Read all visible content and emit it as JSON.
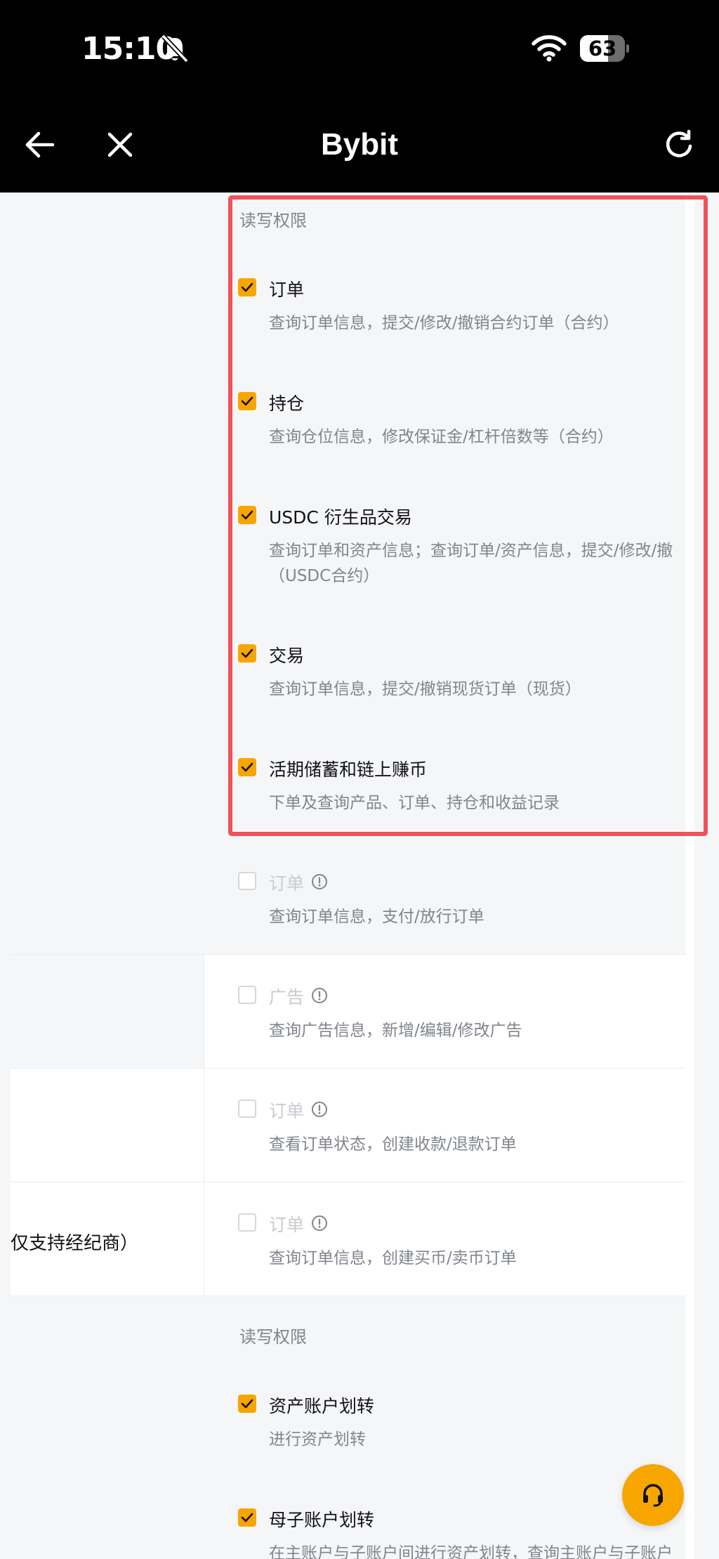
{
  "status_bar": {
    "time": "15:10",
    "battery_level": "63",
    "battery_fraction": 0.63
  },
  "nav": {
    "title": "Bybit",
    "back_icon": "arrow-left-icon",
    "close_icon": "close-icon",
    "refresh_icon": "refresh-icon"
  },
  "permissions": {
    "section1": {
      "header": "读写权限",
      "items": [
        {
          "title": "订单",
          "desc": "查询订单信息，提交/修改/撤销合约订单（合约）",
          "checked": true
        },
        {
          "title": "持仓",
          "desc": "查询仓位信息，修改保证金/杠杆倍数等（合约）",
          "checked": true
        },
        {
          "title": "USDC 衍生品交易",
          "desc": "查询订单和资产信息；查询订单/资产信息，提交/修改/撤",
          "desc2": "（USDC合约）",
          "checked": true
        },
        {
          "title": "交易",
          "desc": "查询订单信息，提交/撤销现货订单（现货）",
          "checked": true
        },
        {
          "title": "活期储蓄和链上赚币",
          "desc": "下单及查询产品、订单、持仓和收益记录",
          "checked": true
        }
      ]
    },
    "p2p_order": {
      "title": "订单",
      "desc": "查询订单信息，支付/放行订单",
      "checked": false
    },
    "p2p_ad": {
      "title": "广告",
      "desc": "查询广告信息，新增/编辑/修改广告",
      "checked": false
    },
    "pay_order": {
      "title": "订单",
      "desc": "查看订单状态，创建收款/退款订单",
      "checked": false
    },
    "broker": {
      "label": "仅支持经纪商）",
      "title": "订单",
      "desc": "查询订单信息，创建买币/卖币订单",
      "checked": false
    },
    "section2": {
      "header": "读写权限",
      "items": [
        {
          "title": "资产账户划转",
          "desc": "进行资产划转",
          "checked": true
        },
        {
          "title": "母子账户划转",
          "desc": "在主账户与子账户间进行资产划转，查询主账户与子账户",
          "checked": true
        }
      ]
    }
  },
  "support": {
    "icon": "headset-icon"
  },
  "colors": {
    "accent": "#f7a600",
    "highlight": "#f0525a",
    "nav_bg": "#000000"
  }
}
